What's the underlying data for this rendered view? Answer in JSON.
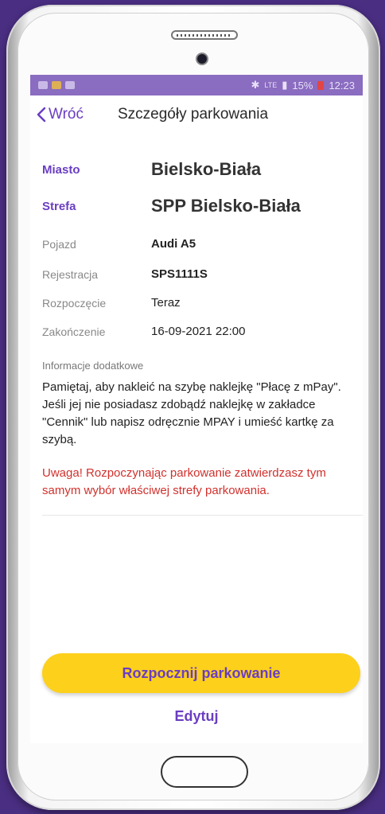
{
  "status_bar": {
    "network": "LTE",
    "battery": "15%",
    "time": "12:23"
  },
  "header": {
    "back_label": "Wróć",
    "title": "Szczegóły parkowania"
  },
  "details": {
    "city_label": "Miasto",
    "city_value": "Bielsko-Biała",
    "zone_label": "Strefa",
    "zone_value": "SPP Bielsko-Biała",
    "vehicle_label": "Pojazd",
    "vehicle_value": "Audi A5",
    "registration_label": "Rejestracja",
    "registration_value": "SPS1111S",
    "start_label": "Rozpoczęcie",
    "start_value": "Teraz",
    "end_label": "Zakończenie",
    "end_value": "16-09-2021 22:00"
  },
  "info": {
    "label": "Informacje dodatkowe",
    "text": "Pamiętaj, aby nakleić na szybę naklejkę \"Płacę z mPay\". Jeśli jej nie posiadasz zdobądź naklejkę w zakładce \"Cennik\" lub napisz odręcznie MPAY i umieść kartkę za szybą.",
    "warning": "Uwaga! Rozpoczynając parkowanie zatwierdzasz tym samym wybór właściwej strefy parkowania."
  },
  "actions": {
    "start_label": "Rozpocznij parkowanie",
    "edit_label": "Edytuj"
  },
  "colors": {
    "accent": "#6a3ec2",
    "button": "#fdd01c",
    "warning": "#d0312d",
    "background": "#4a2e82"
  }
}
